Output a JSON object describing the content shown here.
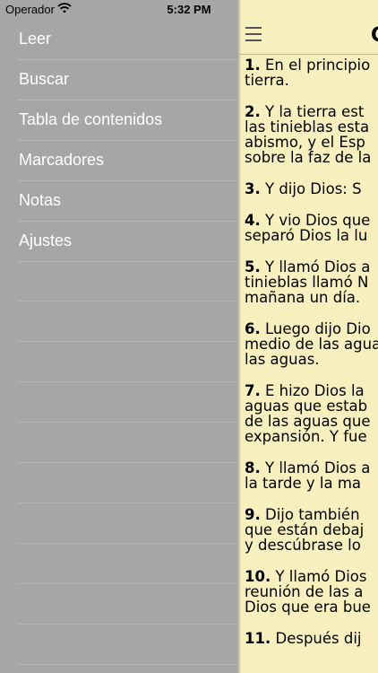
{
  "status_bar": {
    "carrier": "Operador",
    "time": "5:32 PM"
  },
  "menu": {
    "items": [
      {
        "label": "Leer"
      },
      {
        "label": "Buscar"
      },
      {
        "label": "Tabla de contenidos"
      },
      {
        "label": "Marcadores"
      },
      {
        "label": "Notas"
      },
      {
        "label": "Ajustes"
      }
    ]
  },
  "reader": {
    "title": "G",
    "verses": [
      {
        "num": "1.",
        "lines": [
          "En el principio",
          "tierra."
        ]
      },
      {
        "num": "2.",
        "lines": [
          "Y la tierra est",
          "las tinieblas esta",
          "abismo, y el Esp",
          "sobre la faz de la"
        ]
      },
      {
        "num": "3.",
        "lines": [
          "Y dijo Dios: S"
        ]
      },
      {
        "num": "4.",
        "lines": [
          "Y vio Dios que",
          "separó Dios la lu"
        ]
      },
      {
        "num": "5.",
        "lines": [
          "Y llamó Dios a",
          "tinieblas llamó N",
          "mañana un día."
        ]
      },
      {
        "num": "6.",
        "lines": [
          "Luego dijo Dio",
          "medio de las agua",
          "las aguas."
        ]
      },
      {
        "num": "7.",
        "lines": [
          "E hizo Dios la",
          "aguas que estab",
          "de las aguas que",
          "expansión. Y fue"
        ]
      },
      {
        "num": "8.",
        "lines": [
          "Y llamó Dios a",
          "la tarde y la ma"
        ]
      },
      {
        "num": "9.",
        "lines": [
          "Dijo también",
          "que están debaj",
          "y descúbrase lo"
        ]
      },
      {
        "num": "10.",
        "lines": [
          "Y llamó Dios",
          "reunión de las a",
          "Dios que era bue"
        ]
      },
      {
        "num": "11.",
        "lines": [
          "Después dij"
        ]
      }
    ]
  }
}
